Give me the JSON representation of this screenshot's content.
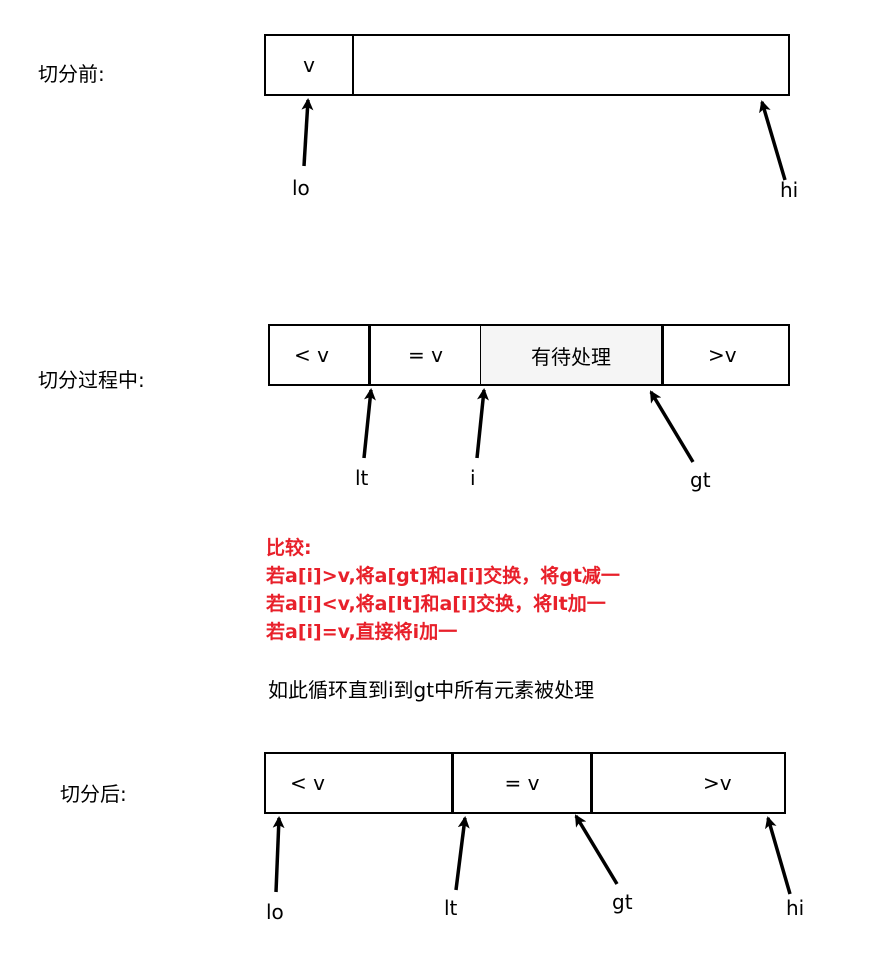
{
  "stages": {
    "before": {
      "title": "切分前:",
      "cells": [
        "v",
        ""
      ],
      "pointers": [
        "lo",
        "hi"
      ]
    },
    "during": {
      "title": "切分过程中:",
      "cells": [
        "< v",
        "= v",
        "有待处理",
        ">v"
      ],
      "pointers": [
        "lt",
        "i",
        "gt"
      ]
    },
    "after": {
      "title": "切分后:",
      "cells": [
        "< v",
        "= v",
        ">v"
      ],
      "pointers": [
        "lo",
        "lt",
        "gt",
        "hi"
      ]
    }
  },
  "compare_note": {
    "heading": "比较:",
    "rules": [
      "若a[i]>v,将a[gt]和a[i]交换，将gt减一",
      "若a[i]<v,将a[lt]和a[i]交换，将lt加一",
      "若a[i]=v,直接将i加一"
    ]
  },
  "loop_note": "如此循环直到i到gt中所有元素被处理",
  "colors": {
    "note_red": "#e8202a",
    "pending_fill": "#f5f5f5",
    "stroke": "#000000"
  }
}
